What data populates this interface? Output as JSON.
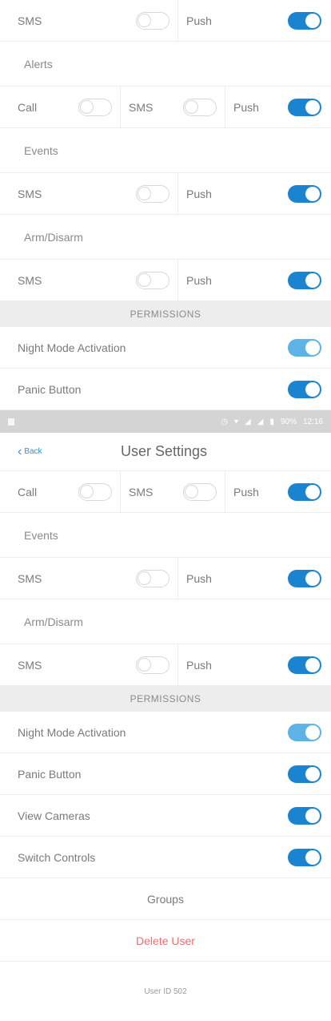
{
  "top_section": {
    "row1": {
      "sms": "SMS",
      "push": "Push"
    },
    "alerts_label": "Alerts",
    "row2": {
      "call": "Call",
      "sms": "SMS",
      "push": "Push"
    },
    "events_label": "Events",
    "row3": {
      "sms": "SMS",
      "push": "Push"
    },
    "arm_label": "Arm/Disarm",
    "row4": {
      "sms": "SMS",
      "push": "Push"
    },
    "permissions_header": "PERMISSIONS",
    "night_mode": "Night Mode Activation",
    "panic_button": "Panic Button"
  },
  "status_bar": {
    "battery": "90%",
    "time": "12:16"
  },
  "nav": {
    "back": "Back",
    "title": "User Settings"
  },
  "bottom_section": {
    "row1": {
      "call": "Call",
      "sms": "SMS",
      "push": "Push"
    },
    "events_label": "Events",
    "row2": {
      "sms": "SMS",
      "push": "Push"
    },
    "arm_label": "Arm/Disarm",
    "row3": {
      "sms": "SMS",
      "push": "Push"
    },
    "permissions_header": "PERMISSIONS",
    "night_mode": "Night Mode Activation",
    "panic_button": "Panic Button",
    "view_cameras": "View Cameras",
    "switch_controls": "Switch Controls",
    "groups": "Groups",
    "delete_user": "Delete User",
    "user_id": "User ID 502"
  },
  "colors": {
    "accent": "#1a84d0",
    "accent_light": "#5eb3e6",
    "danger": "#e57373"
  }
}
